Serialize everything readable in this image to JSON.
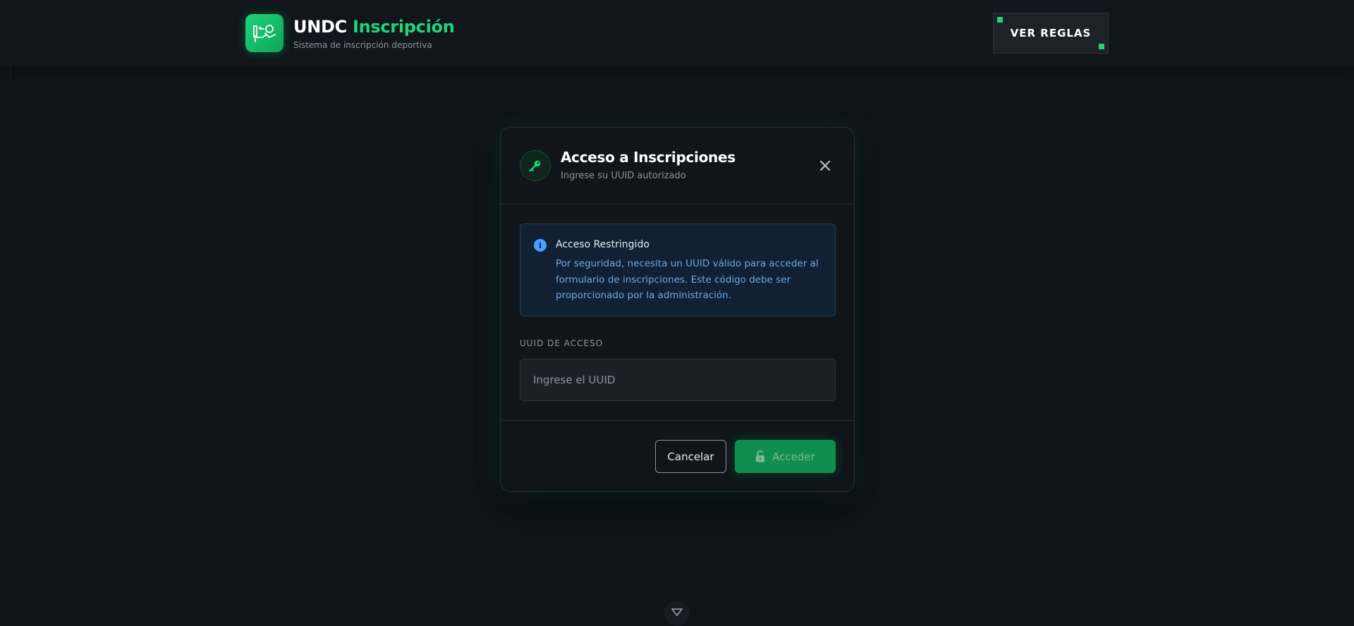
{
  "header": {
    "brand_name": "UNDC",
    "brand_highlight": "Inscripción",
    "brand_subtitle": "Sistema de inscripción deportiva",
    "rules_button": "VER REGLAS"
  },
  "modal": {
    "title": "Acceso a Inscripciones",
    "subtitle": "Ingrese su UUID autorizado",
    "notice": {
      "title": "Acceso Restringido",
      "text": "Por seguridad, necesita un UUID válido para acceder al formulario de inscripciones. Este código debe ser proporcionado por la administración."
    },
    "field_label": "UUID DE ACCESO",
    "input_placeholder": "Ingrese el UUID",
    "input_value": "",
    "cancel_button": "Cancelar",
    "access_button": "Acceder"
  },
  "icons": {
    "logo": "sports-logo-icon",
    "key": "key-icon",
    "close": "close-icon",
    "info": "info-icon",
    "lock": "lock-icon",
    "scroll": "chevron-down-icon"
  },
  "colors": {
    "background": "#0f1419",
    "accent": "#1fd47a",
    "info": "#4a9eff",
    "primary_button": "#0e8f4e"
  }
}
